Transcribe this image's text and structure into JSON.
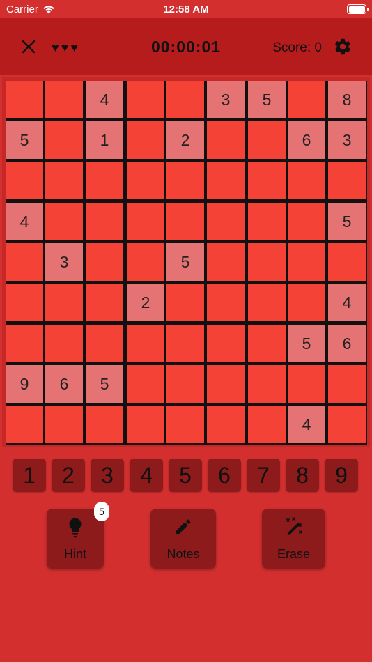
{
  "status_bar": {
    "carrier": "Carrier",
    "time": "12:58 AM"
  },
  "header": {
    "lives": [
      "♥",
      "♥",
      "♥"
    ],
    "timer": "00:00:01",
    "score": "Score: 0"
  },
  "board": {
    "rows": [
      [
        "",
        "",
        "4",
        "",
        "",
        "3",
        "5",
        "",
        "8"
      ],
      [
        "5",
        "",
        "1",
        "",
        "2",
        "",
        "",
        "6",
        "3"
      ],
      [
        "",
        "",
        "",
        "",
        "",
        "",
        "",
        "",
        ""
      ],
      [
        "4",
        "",
        "",
        "",
        "",
        "",
        "",
        "",
        "5"
      ],
      [
        "",
        "3",
        "",
        "",
        "5",
        "",
        "",
        "",
        ""
      ],
      [
        "",
        "",
        "",
        "2",
        "",
        "",
        "",
        "",
        "4"
      ],
      [
        "",
        "",
        "",
        "",
        "",
        "",
        "",
        "5",
        "6"
      ],
      [
        "9",
        "6",
        "5",
        "",
        "",
        "",
        "",
        "",
        ""
      ],
      [
        "",
        "",
        "",
        "",
        "",
        "",
        "",
        "4",
        ""
      ]
    ]
  },
  "numpad": [
    "1",
    "2",
    "3",
    "4",
    "5",
    "6",
    "7",
    "8",
    "9"
  ],
  "tools": {
    "hint": {
      "label": "Hint",
      "badge": "5"
    },
    "notes": {
      "label": "Notes"
    },
    "erase": {
      "label": "Erase"
    }
  },
  "colors": {
    "background": "#d32f2f",
    "app_bar": "#b71c1c",
    "cell": "#f44336",
    "given_cell": "#e57373",
    "button": "#8e1b1b"
  }
}
